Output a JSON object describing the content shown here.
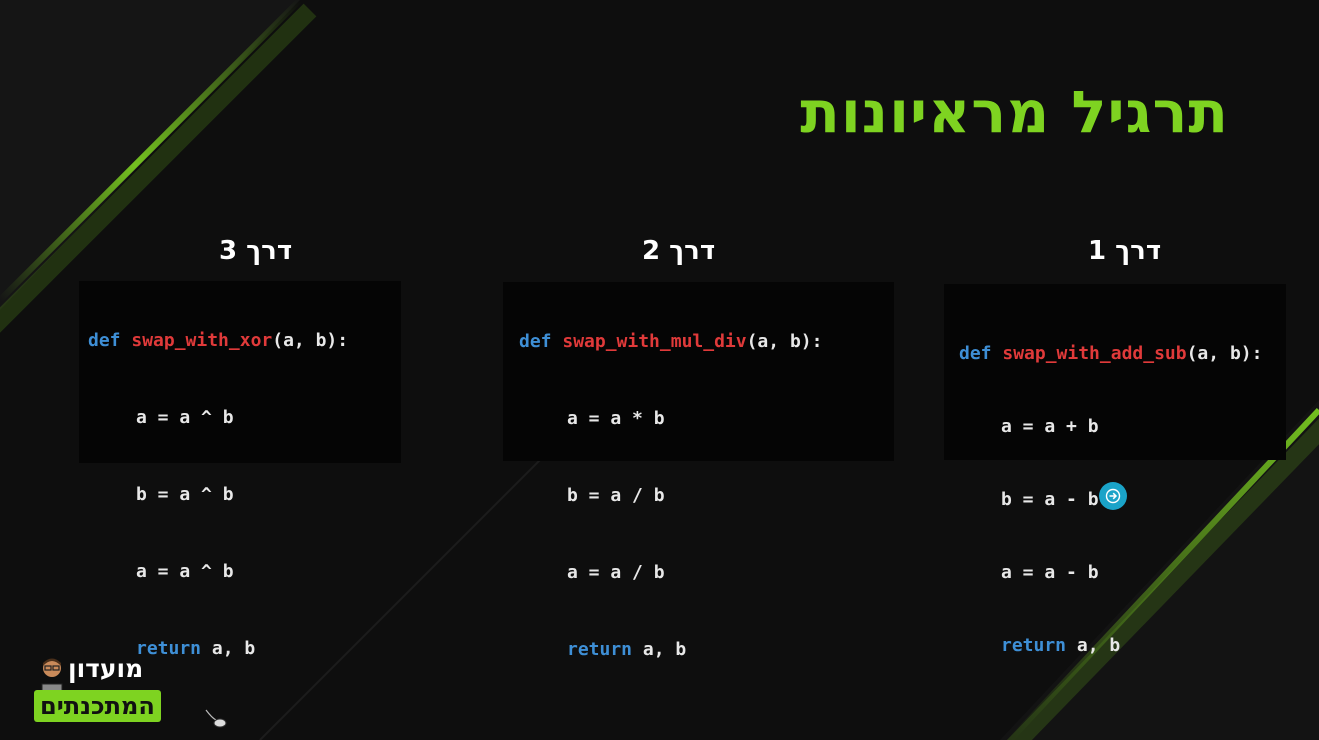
{
  "slide": {
    "title": "תרגיל מראיונות",
    "accent_color": "#7ed321"
  },
  "ways": [
    {
      "label": "דרך 1",
      "code": {
        "keyword_def": "def",
        "function_name": "swap_with_add_sub",
        "signature_rest": "(a, b):",
        "lines": [
          "a = a + b",
          "b = a - b",
          "a = a - b"
        ],
        "keyword_return": "return",
        "return_rest": " a, b"
      }
    },
    {
      "label": "דרך 2",
      "code": {
        "keyword_def": "def",
        "function_name": "swap_with_mul_div",
        "signature_rest": "(a, b):",
        "lines": [
          "a = a * b",
          "b = a / b",
          "a = a / b"
        ],
        "keyword_return": "return",
        "return_rest": " a, b"
      }
    },
    {
      "label": "דרך 3",
      "code": {
        "keyword_def": "def",
        "function_name": "swap_with_xor",
        "signature_rest": "(a, b):",
        "lines": [
          "a = a ^ b",
          "b = a ^ b",
          "a = a ^ b"
        ],
        "keyword_return": "return",
        "return_rest": " a, b"
      }
    }
  ],
  "next_button": {
    "icon": "arrow-right-icon",
    "color": "#1aa3c8"
  },
  "logo": {
    "line1": "מועדון",
    "line2": "המתכנתים"
  }
}
